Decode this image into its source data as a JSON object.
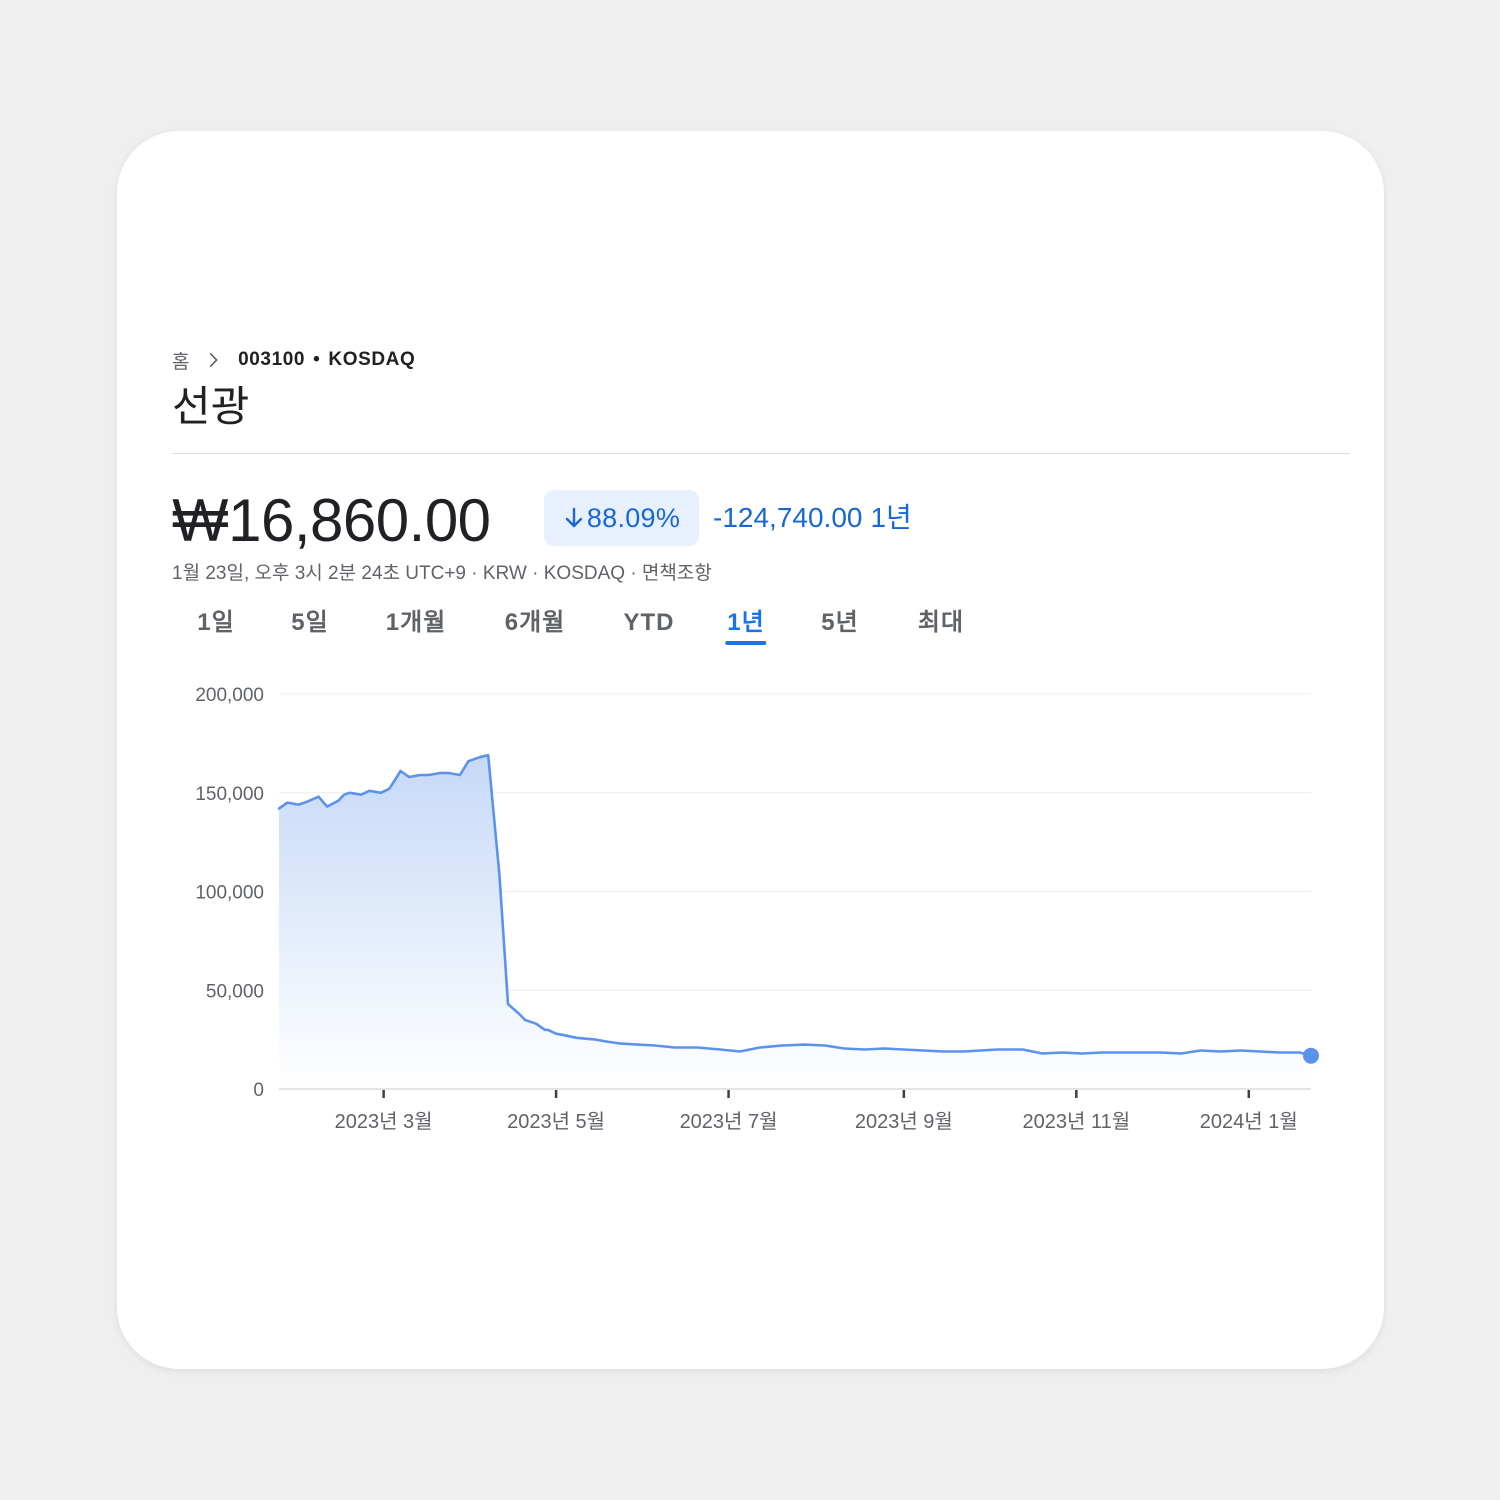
{
  "breadcrumb": {
    "home": "홈",
    "ticker": "003100",
    "separator": "•",
    "exchange": "KOSDAQ"
  },
  "title": "선광",
  "price": {
    "current": "₩16,860.00",
    "change_pct": "88.09%",
    "change_abs": "-124,740.00",
    "period": "1년",
    "direction": "down",
    "meta": "1월 23일, 오후 3시 2분 24초 UTC+9 · KRW · KOSDAQ · 면책조항"
  },
  "tabs": [
    {
      "label": "1일",
      "active": false
    },
    {
      "label": "5일",
      "active": false
    },
    {
      "label": "1개월",
      "active": false
    },
    {
      "label": "6개월",
      "active": false
    },
    {
      "label": "YTD",
      "active": false
    },
    {
      "label": "1년",
      "active": true
    },
    {
      "label": "5년",
      "active": false
    },
    {
      "label": "최대",
      "active": false
    }
  ],
  "colors": {
    "accent": "#1a73e8",
    "line": "#5b93ec",
    "down_text": "#1967d2",
    "chip_bg": "#e8f0fe"
  },
  "chart_data": {
    "type": "area",
    "title": "",
    "xlabel": "",
    "ylabel": "",
    "ylim": [
      0,
      200000
    ],
    "y_ticks": [
      0,
      50000,
      100000,
      150000,
      200000
    ],
    "y_tick_labels": [
      "0",
      "50,000",
      "100,000",
      "150,000",
      "200,000"
    ],
    "x_range": [
      "2023-01-23",
      "2024-01-23"
    ],
    "x_ticks": [
      "2023-03-01",
      "2023-05-01",
      "2023-07-01",
      "2023-09-01",
      "2023-11-01",
      "2024-01-01"
    ],
    "x_tick_labels": [
      "2023년 3월",
      "2023년 5월",
      "2023년 7월",
      "2023년 9월",
      "2023년 11월",
      "2024년 1월"
    ],
    "grid": true,
    "series": [
      {
        "x": [
          "2023-01-23",
          "2023-01-26",
          "2023-01-30",
          "2023-02-02",
          "2023-02-06",
          "2023-02-09",
          "2023-02-13",
          "2023-02-15",
          "2023-02-17",
          "2023-02-21",
          "2023-02-24",
          "2023-02-28",
          "2023-03-03",
          "2023-03-07",
          "2023-03-10",
          "2023-03-14",
          "2023-03-17",
          "2023-03-21",
          "2023-03-24",
          "2023-03-28",
          "2023-03-31",
          "2023-04-04",
          "2023-04-07",
          "2023-04-11",
          "2023-04-14",
          "2023-04-18",
          "2023-04-20",
          "2023-04-24",
          "2023-04-26",
          "2023-04-27",
          "2023-04-28",
          "2023-05-01",
          "2023-05-03",
          "2023-05-08",
          "2023-05-11",
          "2023-05-15",
          "2023-05-19",
          "2023-05-24",
          "2023-05-30",
          "2023-06-05",
          "2023-06-12",
          "2023-06-20",
          "2023-06-28",
          "2023-07-05",
          "2023-07-12",
          "2023-07-20",
          "2023-07-28",
          "2023-08-04",
          "2023-08-11",
          "2023-08-18",
          "2023-08-25",
          "2023-09-01",
          "2023-09-08",
          "2023-09-15",
          "2023-09-22",
          "2023-10-04",
          "2023-10-13",
          "2023-10-20",
          "2023-10-27",
          "2023-11-03",
          "2023-11-10",
          "2023-11-17",
          "2023-11-24",
          "2023-12-01",
          "2023-12-08",
          "2023-12-15",
          "2023-12-22",
          "2023-12-29",
          "2024-01-05",
          "2024-01-12",
          "2024-01-19",
          "2024-01-23"
        ],
        "values": [
          142000,
          145000,
          144000,
          145500,
          148000,
          143000,
          146000,
          149000,
          150000,
          149000,
          151000,
          150000,
          152000,
          161000,
          158000,
          159000,
          159000,
          160000,
          160000,
          159000,
          166000,
          168000,
          169000,
          108000,
          43000,
          38000,
          35000,
          33000,
          31000,
          30000,
          30000,
          28000,
          27500,
          26000,
          25500,
          25000,
          24000,
          23000,
          22500,
          22000,
          21000,
          21000,
          20000,
          19000,
          21000,
          22000,
          22500,
          22000,
          20500,
          20000,
          20500,
          20000,
          19500,
          19000,
          19000,
          20000,
          20000,
          18000,
          18500,
          18000,
          18500,
          18500,
          18500,
          18500,
          18000,
          19500,
          19000,
          19500,
          19000,
          18500,
          18500,
          16860
        ]
      }
    ],
    "last_point": {
      "x": "2024-01-23",
      "value": 16860
    }
  }
}
